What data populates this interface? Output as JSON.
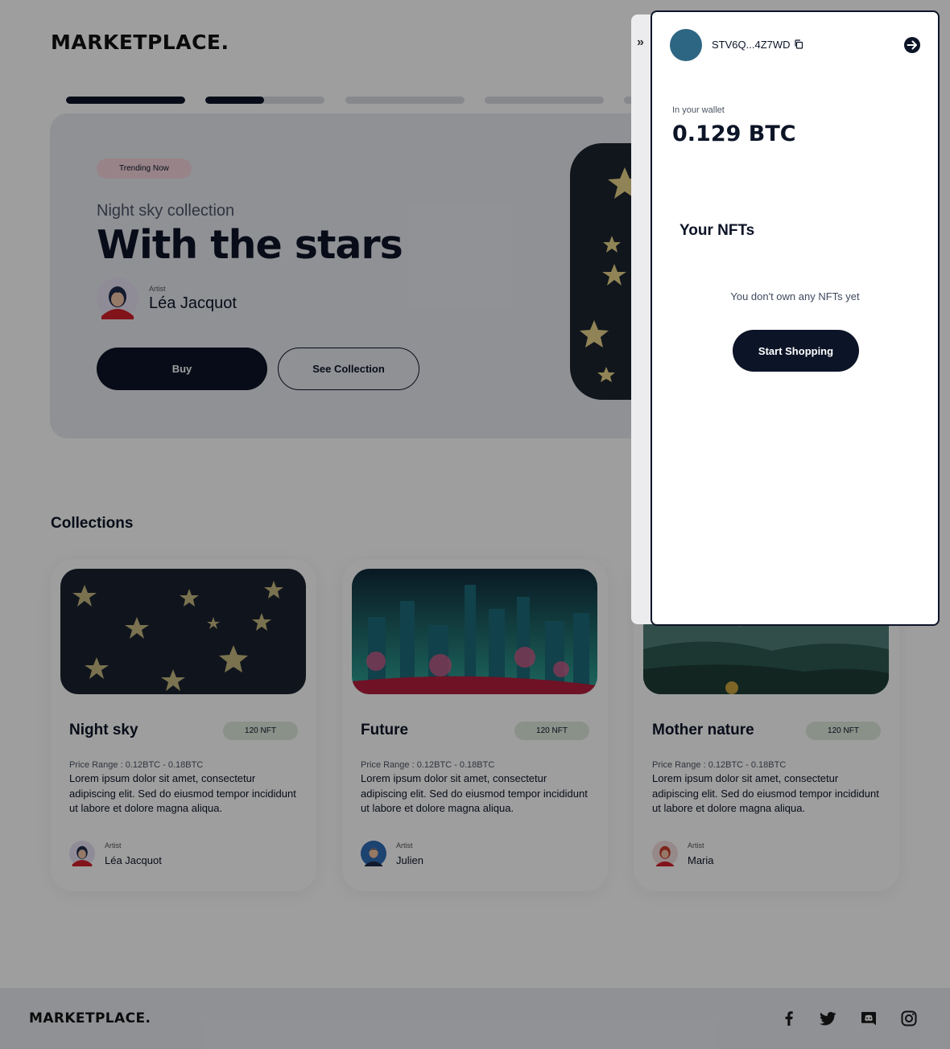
{
  "header": {
    "logo": "MARKETPLACE."
  },
  "carousel": {
    "progress": [
      {
        "fill": 1.0
      },
      {
        "fill": 0.49
      },
      {
        "fill": 0
      },
      {
        "fill": 0
      },
      {
        "fill": 0
      }
    ]
  },
  "hero": {
    "badge": "Trending Now",
    "subtitle": "Night sky collection",
    "title": "With the stars",
    "artist_label": "Artist",
    "artist_name": "Léa Jacquot",
    "buy_label": "Buy",
    "see_collection_label": "See Collection"
  },
  "collections": {
    "title": "Collections",
    "cards": [
      {
        "title": "Night sky",
        "count": "120 NFT",
        "price": "Price Range : 0.12BTC - 0.18BTC",
        "description": "Lorem ipsum dolor sit amet, consectetur adipiscing elit. Sed do eiusmod tempor incididunt ut labore et dolore magna aliqua.",
        "artist_label": "Artist",
        "artist_name": "Léa Jacquot"
      },
      {
        "title": "Future",
        "count": "120 NFT",
        "price": "Price Range : 0.12BTC - 0.18BTC",
        "description": "Lorem ipsum dolor sit amet, consectetur adipiscing elit. Sed do eiusmod tempor incididunt ut labore et dolore magna aliqua.",
        "artist_label": "Artist",
        "artist_name": "Julien"
      },
      {
        "title": "Mother nature",
        "count": "120 NFT",
        "price": "Price Range : 0.12BTC - 0.18BTC",
        "description": "Lorem ipsum dolor sit amet, consectetur adipiscing elit. Sed do eiusmod tempor incididunt ut labore et dolore magna aliqua.",
        "artist_label": "Artist",
        "artist_name": "Maria"
      }
    ]
  },
  "footer": {
    "logo": "MARKETPLACE.",
    "social": [
      "facebook-icon",
      "twitter-icon",
      "discord-icon",
      "instagram-icon"
    ]
  },
  "wallet": {
    "collapse_icon": "»",
    "address": "STV6Q...4Z7WD",
    "balance_label": "In your wallet",
    "balance": "0.129 BTC",
    "nfts_title": "Your NFTs",
    "empty_text": "You don't own any NFTs yet",
    "start_shopping_label": "Start Shopping"
  },
  "colors": {
    "primary": "#0c1427",
    "badge": "#f6d6dc",
    "nft_tag": "#dfeadd",
    "wallet_avatar": "#2d6683"
  }
}
